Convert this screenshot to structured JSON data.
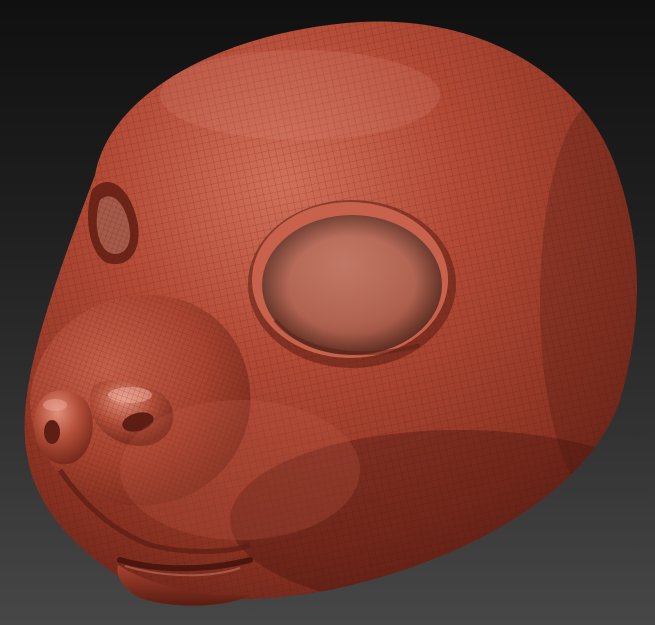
{
  "viewport": {
    "background_top": "#101010",
    "background_bottom": "#474747"
  },
  "model": {
    "subject": "sculpted-animal-head",
    "material_color": "#b34a36",
    "material_shadow": "#5e1e14",
    "material_highlight": "#e49886",
    "wireframe_color": "#4a1810",
    "wireframe_visible": true,
    "parts": [
      "head",
      "eye-socket-left",
      "eye-socket-right",
      "snout",
      "nose",
      "nostrils",
      "mouth"
    ]
  }
}
